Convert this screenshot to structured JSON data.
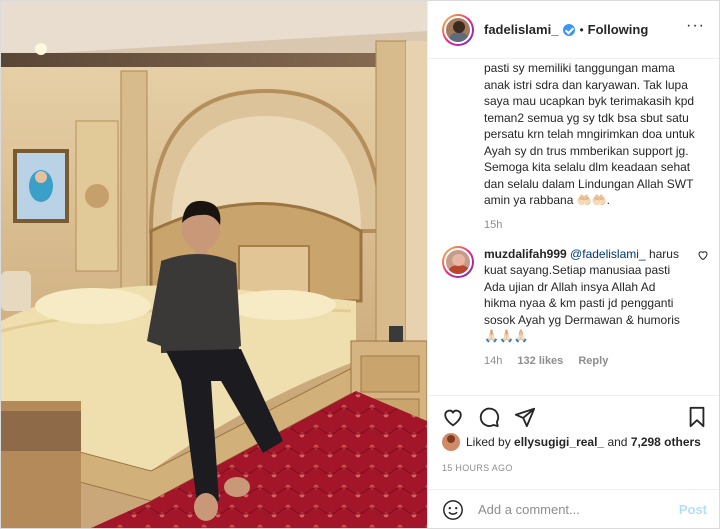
{
  "post": {
    "username": "fadelislami_",
    "dot": "•",
    "follow_label": "Following",
    "more_icon": "more-options-icon"
  },
  "caption": {
    "text": "pasti sy memiliki tanggungan mama anak istri sdra dan karyawan. Tak lupa saya mau ucapkan byk terimakasih kpd teman2 semua yg sy tdk bsa sbut satu persatu krn telah mngirimkan doa untuk Ayah sy dn trus mmberikan support jg. Semoga kita selalu dlm keadaan sehat dan selalu dalam Lindungan Allah SWT amin ya rabbana 🤲🏻🤲🏻.",
    "time": "15h"
  },
  "comment": {
    "username": "muzdalifah999",
    "mention": "@fadelislami_",
    "text": "harus kuat sayang.Setiap manusiaa pasti Ada ujian dr Allah insya Allah Ad hikma nyaa & km pasti jd pengganti sosok Ayah yg Dermawan & humoris 🙏🏻🙏🏻🙏🏻",
    "time": "14h",
    "likes": "132 likes",
    "reply": "Reply"
  },
  "likes": {
    "prefix": "Liked by",
    "user": "ellysugigi_real_",
    "and": "and",
    "count": "7,298 others"
  },
  "timestamp": "15 HOURS AGO",
  "add_comment": {
    "placeholder": "Add a comment...",
    "post_label": "Post"
  },
  "colors": {
    "verified": "#3897f0",
    "link": "#00376b",
    "muted": "#8e8e8e",
    "post_disabled": "#b2dffc"
  }
}
